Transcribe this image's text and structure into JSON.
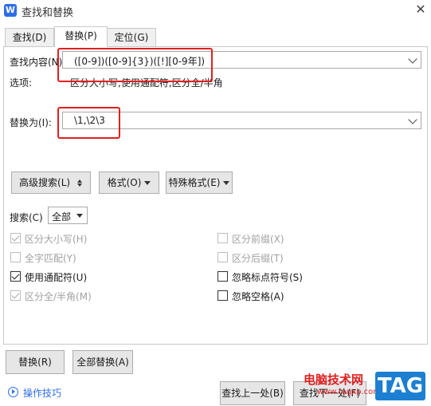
{
  "window": {
    "title": "查找和替换",
    "app_icon_letter": "W"
  },
  "tabs": [
    {
      "label": "查找(D)"
    },
    {
      "label": "替换(P)"
    },
    {
      "label": "定位(G)"
    }
  ],
  "find": {
    "label": "查找内容(N):",
    "value": "([0-9])([0-9]{3})([!][0-9年])"
  },
  "options": {
    "label": "选项:",
    "value": "区分大小写,使用通配符,区分全/半角"
  },
  "replace": {
    "label": "替换为(I):",
    "value": "\\1,\\2\\3"
  },
  "buttons": {
    "advanced": "高级搜索(L)",
    "format": "格式(O)",
    "special": "特殊格式(E)",
    "replace": "替换(R)",
    "replace_all": "全部替换(A)",
    "find_prev": "查找上一处(B)",
    "find_next": "查找下一处(F)"
  },
  "search": {
    "label": "搜索(C)",
    "value": "全部"
  },
  "checkboxes": {
    "match_case": {
      "label": "区分大小写(H)",
      "checked": true,
      "enabled": false
    },
    "whole_word": {
      "label": "全字匹配(Y)",
      "checked": false,
      "enabled": false
    },
    "wildcards": {
      "label": "使用通配符(U)",
      "checked": true,
      "enabled": true
    },
    "width": {
      "label": "区分全/半角(M)",
      "checked": true,
      "enabled": false
    },
    "prefix": {
      "label": "区分前缀(X)",
      "checked": false,
      "enabled": false
    },
    "suffix": {
      "label": "区分后缀(T)",
      "checked": false,
      "enabled": false
    },
    "ignore_punct": {
      "label": "忽略标点符号(S)",
      "checked": false,
      "enabled": true
    },
    "ignore_space": {
      "label": "忽略空格(A)",
      "checked": false,
      "enabled": true
    }
  },
  "tips": {
    "label": "操作技巧"
  },
  "watermark": {
    "site": "电脑技术网",
    "url": "www.tagxp.com",
    "tag": "TAG"
  },
  "colors": {
    "highlight": "#e02020",
    "link": "#2d6ee8",
    "tag": "#1d7fd1"
  }
}
